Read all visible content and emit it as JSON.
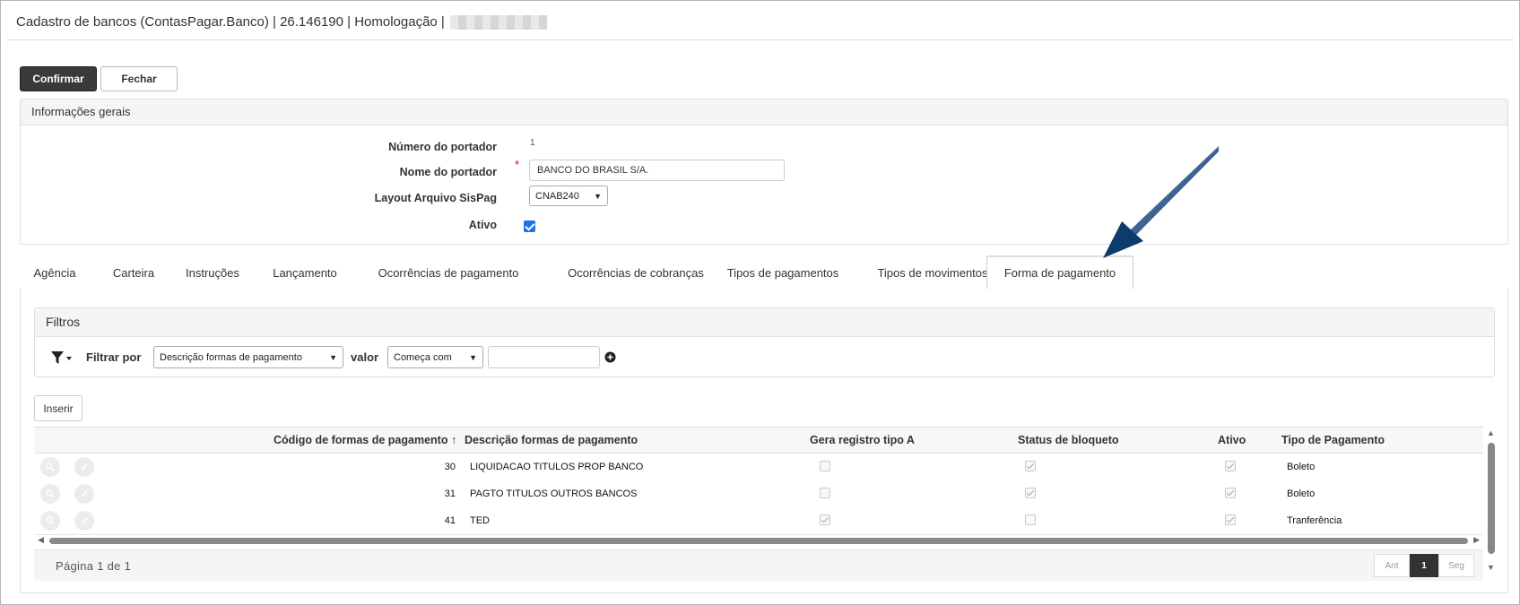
{
  "window": {
    "title": "Cadastro de bancos (ContasPagar.Banco) | 26.146190 | Homologação |"
  },
  "actions": {
    "confirm": "Confirmar",
    "close": "Fechar"
  },
  "general": {
    "section_title": "Informações gerais",
    "numero_label": "Número do portador",
    "numero_value": "1",
    "nome_label": "Nome do portador",
    "nome_value": "BANCO DO BRASIL S/A.",
    "layout_label": "Layout Arquivo SisPag",
    "layout_value": "CNAB240",
    "ativo_label": "Ativo",
    "ativo_checked": true
  },
  "tabs": [
    {
      "label": "Agência"
    },
    {
      "label": "Carteira"
    },
    {
      "label": "Instruções"
    },
    {
      "label": "Lançamento"
    },
    {
      "label": "Ocorrências de pagamento"
    },
    {
      "label": "Ocorrências de cobranças"
    },
    {
      "label": "Tipos de pagamentos"
    },
    {
      "label": "Tipos de movimentos"
    },
    {
      "label": "Forma de pagamento"
    }
  ],
  "active_tab": "Forma de pagamento",
  "filters": {
    "title": "Filtros",
    "filter_by_label": "Filtrar por",
    "filter_field": "Descrição formas de pagamento",
    "value_label": "valor",
    "operator": "Começa com",
    "value": ""
  },
  "grid": {
    "insert_label": "Inserir",
    "columns": {
      "codigo": "Código de formas de pagamento",
      "sort_indicator": "↑",
      "descricao": "Descrição formas de pagamento",
      "gera": "Gera registro tipo A",
      "status": "Status de bloqueto",
      "ativo": "Ativo",
      "tipo": "Tipo de Pagamento"
    },
    "rows": [
      {
        "codigo": "30",
        "descricao": "LIQUIDACAO TITULOS PROP BANCO",
        "gera": false,
        "status": true,
        "ativo": true,
        "tipo": "Boleto"
      },
      {
        "codigo": "31",
        "descricao": "PAGTO TITULOS OUTROS BANCOS",
        "gera": false,
        "status": true,
        "ativo": true,
        "tipo": "Boleto"
      },
      {
        "codigo": "41",
        "descricao": "TED",
        "gera": true,
        "status": false,
        "ativo": true,
        "tipo": "Tranferência"
      }
    ]
  },
  "pager": {
    "text": "Página 1 de 1",
    "prev": "Ant",
    "current": "1",
    "next": "Seg"
  },
  "colors": {
    "primary_button": "#3a3a3a",
    "checkbox_accent": "#1a73e8",
    "annotation_arrow": "#0d3b6e"
  }
}
